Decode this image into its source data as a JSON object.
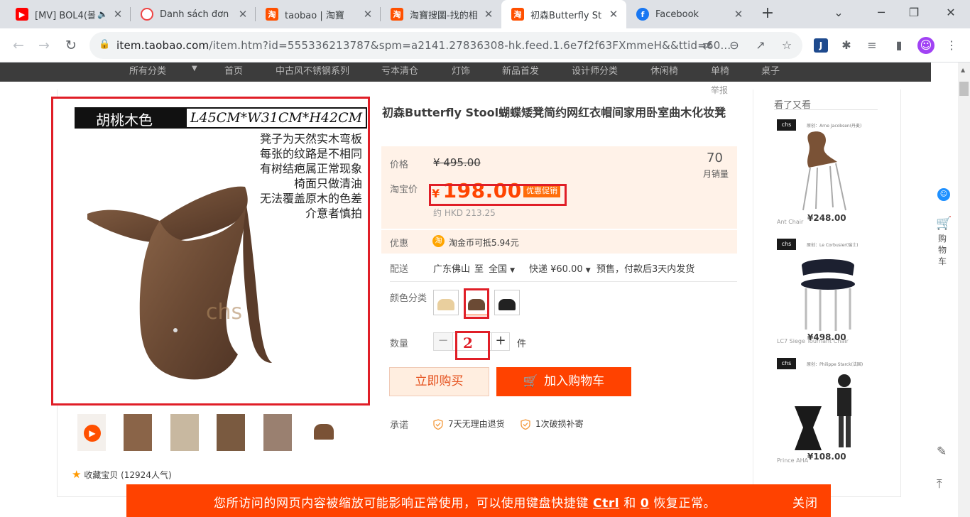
{
  "browser": {
    "tabs": [
      {
        "title": "[MV] BOL4(볼",
        "favicon": "youtube-icon",
        "color": "#ff0000"
      },
      {
        "title": "Danh sách đơn",
        "favicon": "shop-icon",
        "color": "#e33"
      },
      {
        "title": "taobao | 淘寶",
        "favicon": "taobao-icon",
        "color": "#ff5000"
      },
      {
        "title": "淘寶搜圖-找的相",
        "favicon": "taobao-icon",
        "color": "#ff5000"
      },
      {
        "title": "初森Butterfly St",
        "favicon": "taobao-icon",
        "color": "#ff5000"
      },
      {
        "title": "Facebook",
        "favicon": "facebook-icon",
        "color": "#1877f2"
      }
    ],
    "url_host": "item.taobao.com",
    "url_path": "/item.htm?id=555336213787&spm=a2141.27836308-hk.feed.1.6e7f2f63FXmmeH&&ttid=60..."
  },
  "nav": {
    "items": [
      "所有分类",
      "首页",
      "中古风不锈钢系列",
      "亏本清仓",
      "灯饰",
      "新品首发",
      "设计师分类",
      "休闲椅",
      "单椅",
      "桌子"
    ]
  },
  "report": "举报",
  "image": {
    "color_label": "胡桃木色",
    "dimensions": "L45CM*W31CM*H42CM",
    "notes": [
      "凳子为天然实木弯板",
      "每张的纹路是不相同",
      "有树结疤属正常现象",
      "椅面只做清油",
      "无法覆盖原木的色差",
      "介意者慎拍"
    ],
    "brand_mark": "chs"
  },
  "collect": "收藏宝贝 (12924人气)",
  "product": {
    "title": "初森Butterfly Stool蝴蝶矮凳简约网红衣帽间家用卧室曲木化妆凳",
    "price_label": "价格",
    "original_price": "¥ 495.00",
    "sales_count": "70",
    "sales_label": "月销量",
    "taobao_price_label": "淘宝价",
    "currency": "¥",
    "price": "198.00",
    "promo_tag": "优惠促销",
    "hkd": "约 HKD 213.25",
    "coupon_label": "优惠",
    "coupon_text": "淘金币可抵5.94元",
    "coin_glyph": "淘",
    "shipping_label": "配送",
    "ship_from": "广东佛山",
    "ship_to_word": "至",
    "ship_to": "全国",
    "ship_fee": "快递 ¥60.00",
    "ship_note": "预售，付款后3天内发货",
    "color_label": "颜色分类",
    "qty_label": "数量",
    "qty": "2",
    "unit": "件",
    "buy_now": "立即购买",
    "add_cart": "加入购物车",
    "promise_label": "承诺",
    "promise1": "7天无理由退货",
    "promise2": "1次破损补寄"
  },
  "see_more": {
    "title": "看了又看",
    "items": [
      {
        "price": "¥248.00",
        "name": "Ant Chair",
        "caption": "原创：Arne Jacobsen(丹麦)"
      },
      {
        "price": "¥498.00",
        "name": "LC7 Siege Tournant Chair",
        "caption": "原创：Le Corbusier(瑞士)"
      },
      {
        "price": "¥108.00",
        "name": "Prince AHA",
        "caption": "原创：Philippe Starck(法国)"
      }
    ]
  },
  "sidebar": {
    "cart_label": "购物车"
  },
  "zoom_notice": {
    "pre": "您所访问的网页内容被缩放可能影响正常使用，可以使用键盘快捷键 ",
    "key1": "Ctrl",
    "mid": " 和 ",
    "key2": "0",
    "post": " 恢复正常。",
    "close": "关闭"
  },
  "colors": {
    "accent": "#ff4400",
    "highlight": "#e01e27",
    "button": "#ff4200"
  }
}
